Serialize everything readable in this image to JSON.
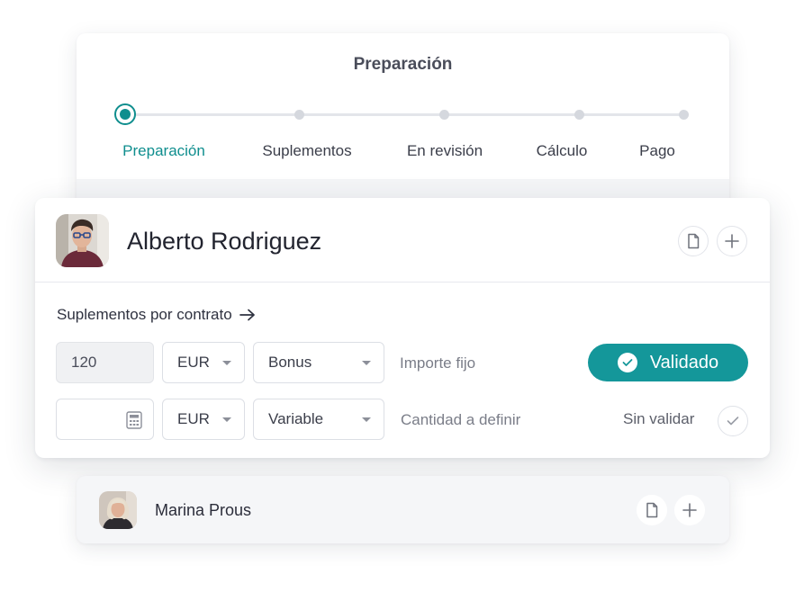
{
  "stepper": {
    "title": "Preparación",
    "steps": [
      {
        "label": "Preparación",
        "active": true
      },
      {
        "label": "Suplementos",
        "active": false
      },
      {
        "label": "En revisión",
        "active": false
      },
      {
        "label": "Cálculo",
        "active": false
      },
      {
        "label": "Pago",
        "active": false
      }
    ]
  },
  "main_card": {
    "person_name": "Alberto Rodriguez",
    "avatar_icon": "avatar-photo",
    "actions": [
      "document-icon",
      "plus-icon"
    ],
    "section_label": "Suplementos por contrato",
    "section_icon": "arrow-right-icon",
    "rows": [
      {
        "amount": "120",
        "currency": "EUR",
        "type": "Bonus",
        "hint": "Importe fijo",
        "status": "Validado",
        "validated": true
      },
      {
        "amount": "",
        "amount_icon": "calculator-icon",
        "currency": "EUR",
        "type": "Variable",
        "hint": "Cantidad a definir",
        "status": "Sin validar",
        "validated": false
      }
    ]
  },
  "bottom_card": {
    "person_name": "Marina Prous",
    "avatar_icon": "avatar-photo",
    "actions": [
      "document-icon",
      "plus-icon"
    ]
  },
  "colors": {
    "accent": "#0f8e8e",
    "validated_bg": "#14979a",
    "muted_text": "#7a7d88"
  }
}
